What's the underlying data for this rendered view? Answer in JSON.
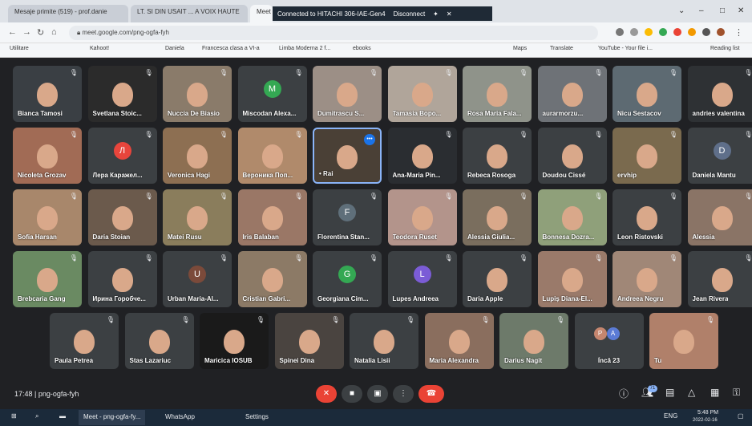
{
  "browser": {
    "tabs": [
      {
        "title": "Mesaje primite (519) - prof.danie",
        "active": false
      },
      {
        "title": "LT. SI DIN USAIT ... A VOIX HAUTE",
        "active": false
      },
      {
        "title": "Meet",
        "active": true
      }
    ],
    "remote_banner": {
      "text": "Connected to HITACHI 306-IAE-Gen4",
      "disconnect": "Disconnect"
    },
    "url": "meet.google.com/png-ogfa-fyh",
    "bookmarks": [
      "Utilitare",
      "Kahoot!",
      "Daniela",
      "Francesca clasa a VI-a",
      "Limba Moderna 2 f...",
      "ebooks",
      "Maps",
      "Translate",
      "YouTube - Your file i...",
      "Reading list"
    ]
  },
  "participants": [
    {
      "name": "Bianca Tamosi",
      "type": "face",
      "bg": "#3a3f44"
    },
    {
      "name": "Svetlana Stoic...",
      "type": "face",
      "bg": "#2b2b2b"
    },
    {
      "name": "Nuccia De Biasio",
      "type": "face",
      "bg": "#8a7b6a"
    },
    {
      "name": "Miscodan Alexa...",
      "type": "avatar",
      "letter": "M",
      "color": "#34a853"
    },
    {
      "name": "Dumitrascu S...",
      "type": "face",
      "bg": "#9c8f86"
    },
    {
      "name": "Tamasia Bopo...",
      "type": "face",
      "bg": "#b0a59a"
    },
    {
      "name": "Rosa Maria Fala...",
      "type": "face",
      "bg": "#8f938a"
    },
    {
      "name": "aurarmorzu...",
      "type": "face",
      "bg": "#6e7277"
    },
    {
      "name": "Nicu Sestacov",
      "type": "face",
      "bg": "#5d6a72"
    },
    {
      "name": "andries valentina",
      "type": "face",
      "bg": "#2e3134"
    },
    {
      "name": "Nicoleta Grozav",
      "type": "face",
      "bg": "#a16b55"
    },
    {
      "name": "Лера Каражел...",
      "type": "avatar",
      "letter": "Л",
      "color": "#e8453c"
    },
    {
      "name": "Veronica Hagi",
      "type": "face",
      "bg": "#8d6f52"
    },
    {
      "name": "Вероника Поп...",
      "type": "face",
      "bg": "#b08a6b"
    },
    {
      "name": "• Rai",
      "type": "face",
      "bg": "#4a4036",
      "selected": true
    },
    {
      "name": "Ana-Maria Pin...",
      "type": "face",
      "bg": "#2a2d31"
    },
    {
      "name": "Rebeca Rosoga",
      "type": "face",
      "bg": "#3c4043"
    },
    {
      "name": "Doudou Cissé",
      "type": "face",
      "bg": "#3c4043"
    },
    {
      "name": "ervhip",
      "type": "face",
      "bg": "#7a6a4e"
    },
    {
      "name": "Daniela Mantu",
      "type": "avatar",
      "letter": "D",
      "color": "#5f6f8a"
    },
    {
      "name": "Sofia Harsan",
      "type": "face",
      "bg": "#a8876b"
    },
    {
      "name": "Daria Stoian",
      "type": "face",
      "bg": "#6b5a4c"
    },
    {
      "name": "Matei Rusu",
      "type": "face",
      "bg": "#8a7d5c"
    },
    {
      "name": "Iris Balaban",
      "type": "face",
      "bg": "#9a7766"
    },
    {
      "name": "Florentina Stan...",
      "type": "avatar",
      "letter": "F",
      "color": "#5f6f7a"
    },
    {
      "name": "Teodora Ruset",
      "type": "face",
      "bg": "#b3948b"
    },
    {
      "name": "Alessia Giulia...",
      "type": "face",
      "bg": "#7a6e5e"
    },
    {
      "name": "Bonnesa Dozra...",
      "type": "face",
      "bg": "#8fa07a"
    },
    {
      "name": "Leon Ristovski",
      "type": "face",
      "bg": "#3c4043"
    },
    {
      "name": "Alessia",
      "type": "face",
      "bg": "#8a7466"
    },
    {
      "name": "Brebcaria Gang",
      "type": "face",
      "bg": "#6a8a62"
    },
    {
      "name": "Ирина Горобче...",
      "type": "face",
      "bg": "#3c4043"
    },
    {
      "name": "Urban Maria-Al...",
      "type": "avatar",
      "letter": "U",
      "color": "#7b4a3a"
    },
    {
      "name": "Cristian Gabri...",
      "type": "face",
      "bg": "#8c7a66"
    },
    {
      "name": "Georgiana Cim...",
      "type": "avatar",
      "letter": "G",
      "color": "#34a853"
    },
    {
      "name": "Lupes Andreea",
      "type": "avatar",
      "letter": "L",
      "color": "#7b5cd6"
    },
    {
      "name": "Daria Apple",
      "type": "face",
      "bg": "#3c4043"
    },
    {
      "name": "Lupiș Diana-El...",
      "type": "face",
      "bg": "#9a7a6a"
    },
    {
      "name": "Andreea Negru",
      "type": "face",
      "bg": "#a08777"
    },
    {
      "name": "Jean Rivera",
      "type": "face",
      "bg": "#3c4043"
    },
    {
      "name": "Paula Petrea",
      "type": "face",
      "bg": "#3c4043"
    },
    {
      "name": "Stas Lazariuc",
      "type": "face",
      "bg": "#3c4043"
    },
    {
      "name": "Maricica IOSUB",
      "type": "face",
      "bg": "#1a1a1a"
    },
    {
      "name": "Spinei Dina",
      "type": "face",
      "bg": "#4a4440"
    },
    {
      "name": "Natalia Lisii",
      "type": "face",
      "bg": "#3c4043"
    },
    {
      "name": "Maria Alexandra",
      "type": "face",
      "bg": "#8a6e5e"
    },
    {
      "name": "Darius Nagit",
      "type": "face",
      "bg": "#6d7a6a"
    },
    {
      "name": "Încă 23",
      "type": "overflow",
      "letters": [
        "P",
        "A"
      ]
    },
    {
      "name": "Tu",
      "type": "face",
      "bg": "#b0806a"
    }
  ],
  "bottom_bar": {
    "time": "17:48",
    "separator": "|",
    "meeting_code": "png-ogfa-fyh",
    "people_count": "71"
  },
  "taskbar": {
    "apps": [
      "Meet - png-ogfa-fy...",
      "WhatsApp",
      "Settings"
    ],
    "lang": "ENG",
    "time": "5:48 PM",
    "date": "2022-02-16"
  },
  "colors": {
    "meet_bg": "#202124",
    "tile_bg": "#3c4043",
    "leave_red": "#ea4335",
    "accent_blue": "#8ab4f8"
  }
}
